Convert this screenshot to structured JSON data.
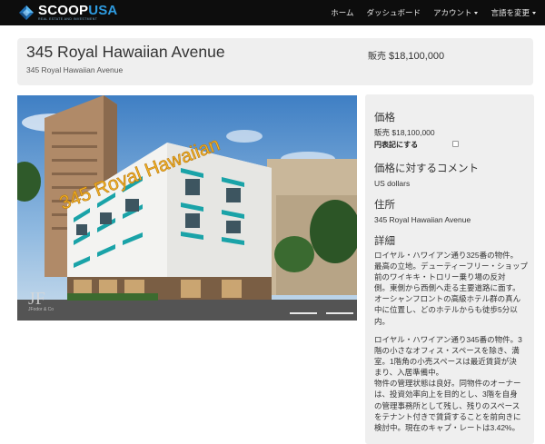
{
  "navbar": {
    "brand_prefix": "SCOOP",
    "brand_suffix": "USA",
    "brand_tagline": "REAL ESTATE AND INVESTMENT",
    "items": [
      {
        "label": "ホーム"
      },
      {
        "label": "ダッシュボード"
      },
      {
        "label": "アカウント"
      },
      {
        "label": "言語を変更"
      }
    ],
    "colors": {
      "background": "#0d0d0d",
      "brand_accent": "#2e9be0"
    }
  },
  "listing": {
    "title": "345 Royal Hawaiian Avenue",
    "subtitle": "345 Royal Hawaiian Avenue",
    "price_label": "販売",
    "price_value": "$18,100,000"
  },
  "photo": {
    "overlay_text": "345 Royal Hawaiian",
    "watermark_logo": "JF",
    "watermark_text": "JFodor & Co"
  },
  "details": {
    "price_heading": "価格",
    "price_line": "販売 $18,100,000",
    "yen_toggle_label": "円表記にする",
    "price_comment_heading": "価格に対するコメント",
    "price_comment": "US dollars",
    "address_heading": "住所",
    "address": "345 Royal Hawaiian Avenue",
    "details_heading": "詳細",
    "paragraph1_lines": [
      "ロイヤル・ハワイアン通り325番の物件。",
      "最高の立地。デューティーフリー・ショップ",
      "前のワイキキ・トロリー乗り場の反対",
      "側。東側から西側へ走る主要道路に面す。",
      "オーシャンフロントの高級ホテル群の真ん",
      "中に位置し、どのホテルからも徒歩5分以",
      "内。"
    ],
    "paragraph2_lines": [
      "ロイヤル・ハワイアン通り345番の物件。3",
      "階の小さなオフィス・スペースを除き、満",
      "室。1階角の小売スペースは最近賃貸が決",
      "まり、入居準備中。",
      "物件の管理状態は良好。同物件のオーナー",
      "は、投資効率向上を目的とし、3階を自身",
      "の管理事務所として残し、残りのスペース",
      "をテナント付きで賃貸することを前向きに",
      "検討中。現在のキャプ・レートは3.42%。"
    ]
  }
}
